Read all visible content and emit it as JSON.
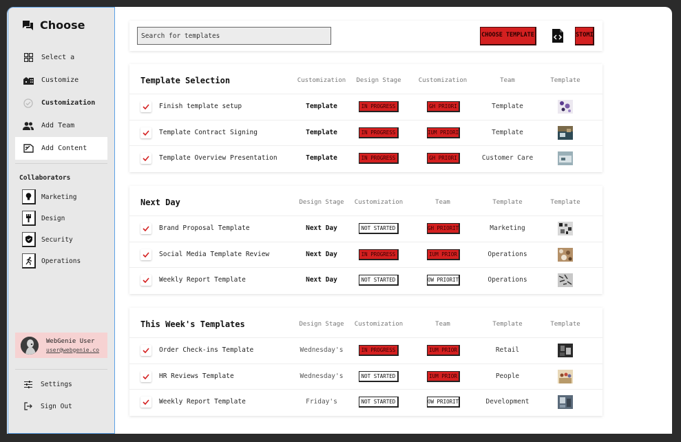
{
  "sidebar": {
    "brand": "Choose",
    "nav": [
      {
        "label": "Select a",
        "icon": "grid-icon"
      },
      {
        "label": "Customize",
        "icon": "buildings-icon"
      },
      {
        "label": "Customization",
        "icon": "check-circle-icon"
      },
      {
        "label": "Add Team",
        "icon": "people-icon"
      },
      {
        "label": "Add Content",
        "icon": "add-content-icon"
      }
    ],
    "collaborators_title": "Collaborators",
    "collaborators": [
      {
        "label": "Marketing",
        "icon": "bulb-icon"
      },
      {
        "label": "Design",
        "icon": "brush-icon"
      },
      {
        "label": "Security",
        "icon": "shield-icon"
      },
      {
        "label": "Operations",
        "icon": "runner-icon"
      }
    ],
    "user": {
      "name": "WebGenie User",
      "email": "user@webgenie.co"
    },
    "settings": "Settings",
    "sign_out": "Sign Out"
  },
  "topbar": {
    "search_placeholder": "Search for templates",
    "choose_button": "CHOOSE TEMPLATE",
    "custom_button": "STOMI"
  },
  "colors": {
    "accent_red": "#d42020",
    "active_nav": "#ffffff",
    "user_card": "#f6d2d2"
  },
  "sections": [
    {
      "title": "Template Selection",
      "columns": [
        "Customization",
        "Design Stage",
        "Customization",
        "Team",
        "Template"
      ],
      "rows": [
        {
          "name": "Finish template setup",
          "c1": "Template",
          "status": "IN PROGRESS",
          "status_style": "red",
          "priority": "GH PRIORI",
          "priority_style": "red",
          "team": "Template",
          "thumb": "purple-pattern"
        },
        {
          "name": "Template Contract Signing",
          "c1": "Template",
          "status": "IN PROGRESS",
          "status_style": "red",
          "priority": "IUM PRIORI",
          "priority_style": "red",
          "team": "Template",
          "thumb": "office-photo"
        },
        {
          "name": "Template Overview Presentation",
          "c1": "Template",
          "status": "IN PROGRESS",
          "status_style": "red",
          "priority": "GH PRIORI",
          "priority_style": "red",
          "team": "Customer Care",
          "thumb": "desk-photo"
        }
      ]
    },
    {
      "title": "Next Day",
      "columns": [
        "Design Stage",
        "Customization",
        "Team",
        "Template",
        "Template"
      ],
      "rows": [
        {
          "name": "Brand Proposal Template",
          "c1": "Next Day",
          "status": "NOT STARTED",
          "status_style": "white",
          "priority": "GH PRIORIT",
          "priority_style": "red",
          "team": "Marketing",
          "thumb": "mosaic-photo"
        },
        {
          "name": "Social Media Template Review",
          "c1": "Next Day",
          "status": "IN PROGRESS",
          "status_style": "red",
          "priority": "IUM PRIOR",
          "priority_style": "red",
          "team": "Operations",
          "thumb": "texture-photo"
        },
        {
          "name": "Weekly Report Template",
          "c1": "Next Day",
          "status": "NOT STARTED",
          "status_style": "white",
          "priority": "OW PRIORIT",
          "priority_style": "white",
          "team": "Operations",
          "thumb": "speckle-photo"
        }
      ]
    },
    {
      "title": "This Week's Templates",
      "columns": [
        "Design Stage",
        "Customization",
        "Team",
        "Template",
        "Template"
      ],
      "rows": [
        {
          "name": "Order Check-ins Template",
          "c1": "Wednesday's",
          "status": "IN PROGRESS",
          "status_style": "red",
          "priority": "IUM PRIOR",
          "priority_style": "red",
          "team": "Retail",
          "thumb": "dark-photo"
        },
        {
          "name": "HR Reviews Template",
          "c1": "Wednesday's",
          "status": "NOT STARTED",
          "status_style": "white",
          "priority": "IUM PRIOR",
          "priority_style": "red",
          "team": "People",
          "thumb": "people-photo"
        },
        {
          "name": "Weekly Report Template",
          "c1": "Friday's",
          "status": "NOT STARTED",
          "status_style": "white",
          "priority": "OW PRIORIT",
          "priority_style": "white",
          "team": "Development",
          "thumb": "room-photo"
        }
      ]
    }
  ]
}
